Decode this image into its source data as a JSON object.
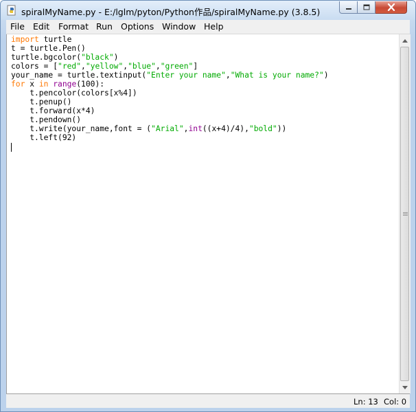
{
  "window": {
    "title": "spiralMyName.py - E:/lglm/pyton/Python作品/spiralMyName.py (3.8.5)"
  },
  "menu": {
    "items": [
      "File",
      "Edit",
      "Format",
      "Run",
      "Options",
      "Window",
      "Help"
    ]
  },
  "editor": {
    "lines": [
      [
        {
          "t": "import",
          "c": "kw"
        },
        {
          "t": " turtle"
        }
      ],
      [
        {
          "t": "t = turtle.Pen()"
        }
      ],
      [
        {
          "t": "turtle.bgcolor("
        },
        {
          "t": "\"black\"",
          "c": "str"
        },
        {
          "t": ")"
        }
      ],
      [
        {
          "t": "colors = ["
        },
        {
          "t": "\"red\"",
          "c": "str"
        },
        {
          "t": ","
        },
        {
          "t": "\"yellow\"",
          "c": "str"
        },
        {
          "t": ","
        },
        {
          "t": "\"blue\"",
          "c": "str"
        },
        {
          "t": ","
        },
        {
          "t": "\"green\"",
          "c": "str"
        },
        {
          "t": "]"
        }
      ],
      [
        {
          "t": "your_name = turtle.textinput("
        },
        {
          "t": "\"Enter your name\"",
          "c": "str"
        },
        {
          "t": ","
        },
        {
          "t": "\"What is your name?\"",
          "c": "str"
        },
        {
          "t": ")"
        }
      ],
      [
        {
          "t": "for",
          "c": "kw"
        },
        {
          "t": " x "
        },
        {
          "t": "in",
          "c": "kw"
        },
        {
          "t": " "
        },
        {
          "t": "range",
          "c": "bi"
        },
        {
          "t": "(100):"
        }
      ],
      [
        {
          "t": "    t.pencolor(colors[x%4])"
        }
      ],
      [
        {
          "t": "    t.penup()"
        }
      ],
      [
        {
          "t": "    t.forward(x*4)"
        }
      ],
      [
        {
          "t": "    t.pendown()"
        }
      ],
      [
        {
          "t": "    t.write(your_name,font = ("
        },
        {
          "t": "\"Arial\"",
          "c": "str"
        },
        {
          "t": ","
        },
        {
          "t": "int",
          "c": "bi"
        },
        {
          "t": "((x+4)/4),"
        },
        {
          "t": "\"bold\"",
          "c": "str"
        },
        {
          "t": "))"
        }
      ],
      [
        {
          "t": "    t.left(92)"
        }
      ],
      [
        {
          "t": ""
        }
      ]
    ]
  },
  "statusbar": {
    "line": "Ln: 13",
    "col": "Col: 0"
  },
  "icons": {
    "app": "python-idle-icon",
    "minimize": "minimize-icon",
    "maximize": "maximize-icon",
    "close": "close-icon",
    "scroll_up": "arrow-up-icon",
    "scroll_down": "arrow-down-icon"
  },
  "colors": {
    "keyword": "#ff7700",
    "builtin": "#900090",
    "string": "#00aa00",
    "close_button": "#c74a36"
  }
}
